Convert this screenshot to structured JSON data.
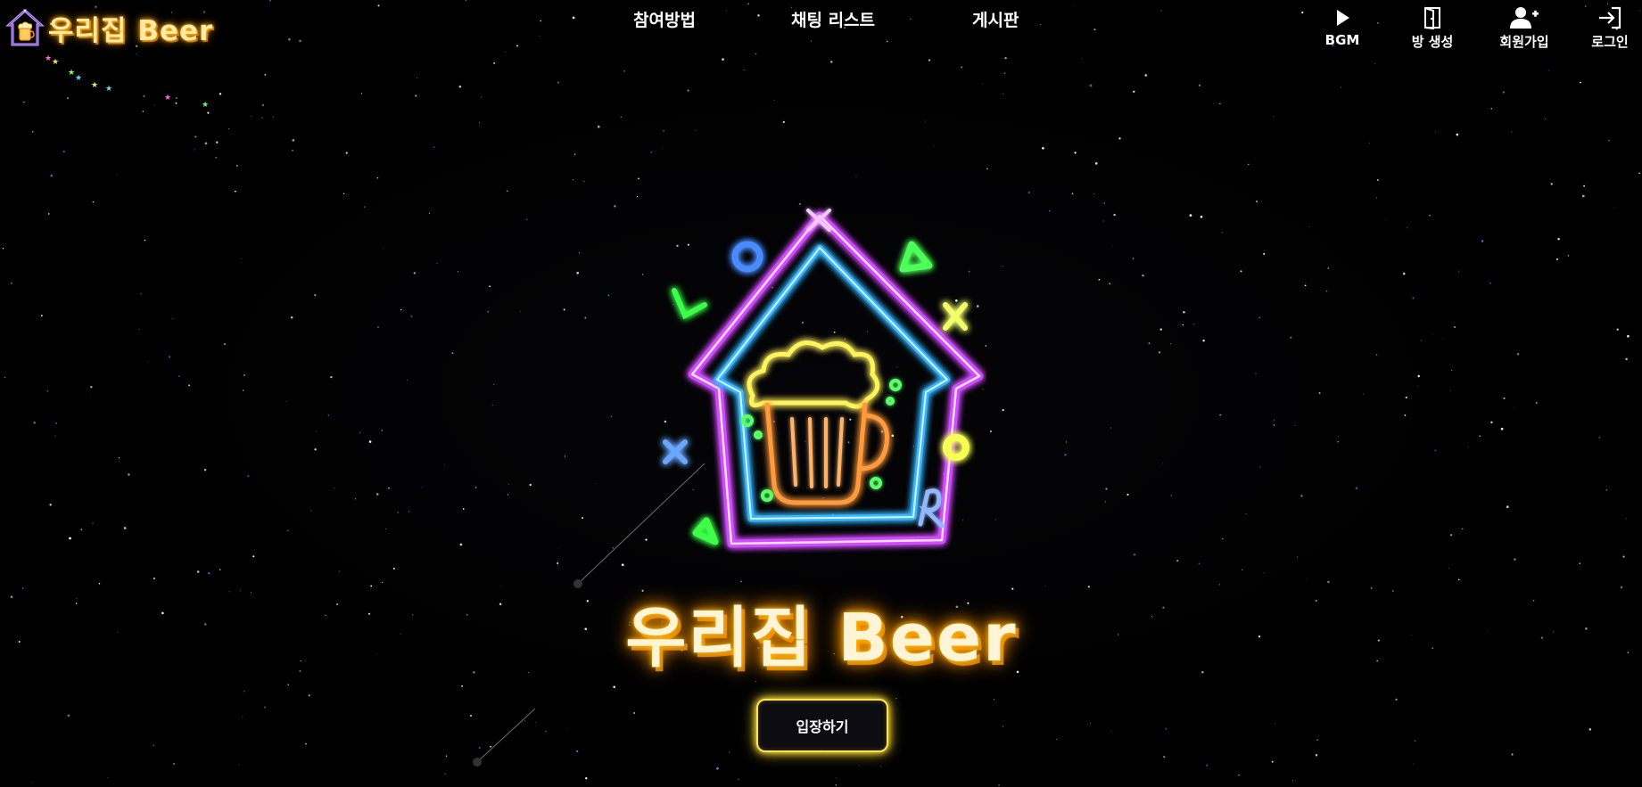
{
  "brand": {
    "title": "우리집 Beer"
  },
  "nav": {
    "links": [
      "참여방법",
      "채팅 리스트",
      "게시판"
    ],
    "actions": [
      {
        "label": "BGM",
        "icon": "play-icon"
      },
      {
        "label": "방 생성",
        "icon": "door-icon"
      },
      {
        "label": "회원가입",
        "icon": "user-plus-icon"
      },
      {
        "label": "로그인",
        "icon": "login-icon"
      }
    ]
  },
  "hero": {
    "title": "우리집 Beer",
    "enter_label": "입장하기"
  },
  "colors": {
    "neon_purple": "#d24cff",
    "neon_blue": "#38b6ff",
    "neon_yellow": "#ffe44d",
    "neon_orange": "#ff9a3c",
    "neon_green": "#5cff6a",
    "title_glow": "#ffb300"
  }
}
